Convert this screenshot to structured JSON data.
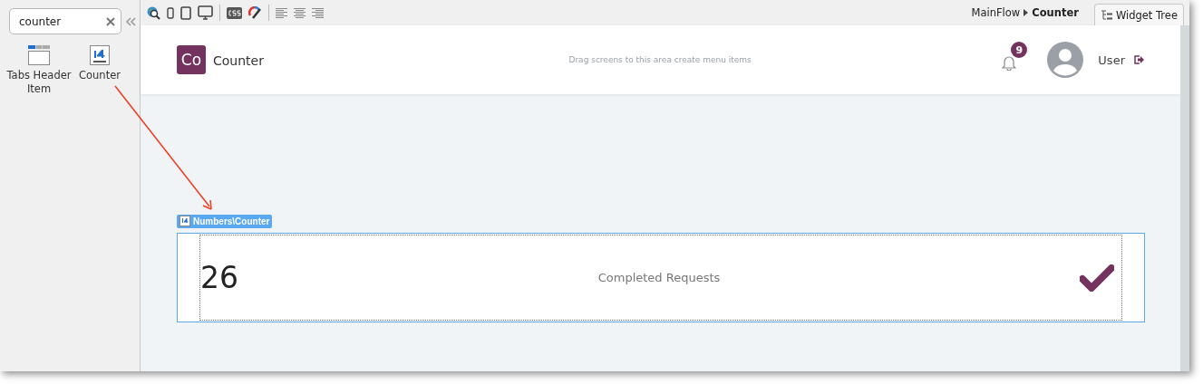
{
  "sidebar": {
    "search": {
      "value": "counter"
    },
    "items": [
      {
        "kind": "tabs",
        "label": "Tabs Header Item"
      },
      {
        "kind": "counter",
        "label": "Counter"
      }
    ]
  },
  "toolbar": {
    "breadcrumb": {
      "flow": "MainFlow",
      "screen": "Counter"
    },
    "widget_tree": "Widget Tree"
  },
  "header": {
    "logo": "Co",
    "app_name": "Counter",
    "menu_hint": "Drag screens to this area create menu items",
    "notifications": "9",
    "user": "User"
  },
  "widget": {
    "label": "Numbers\\Counter",
    "value": "26",
    "caption": "Completed Requests"
  }
}
